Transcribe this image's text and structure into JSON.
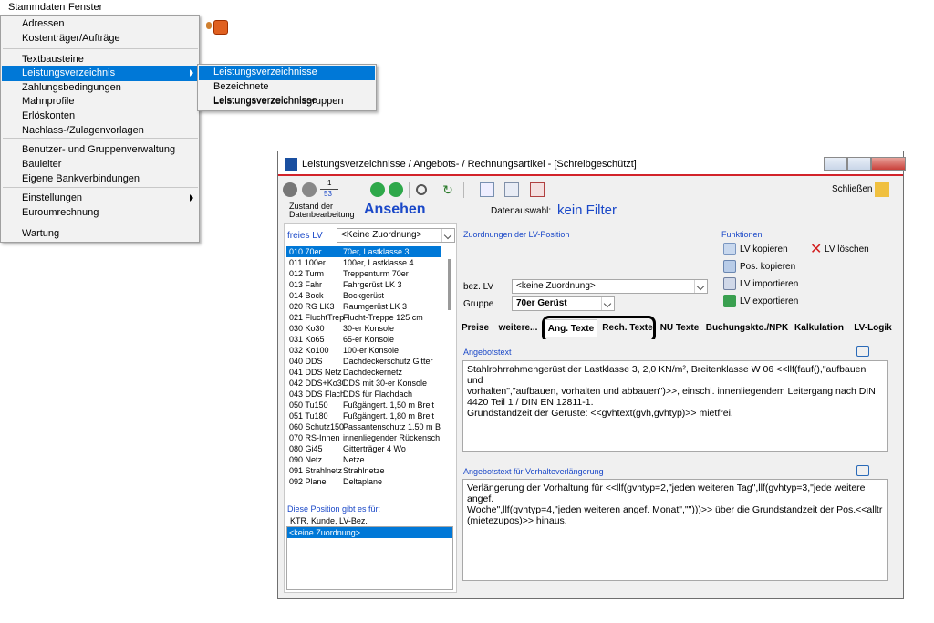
{
  "menubar": {
    "stammdaten": "Stammdaten",
    "fenster": "Fenster"
  },
  "dropdown": {
    "items": [
      {
        "label": "Adressen"
      },
      {
        "label": "Kostenträger/Aufträge"
      },
      {
        "label": "Textbausteine"
      },
      {
        "label": "Leistungsverzeichnis"
      },
      {
        "label": "Zahlungsbedingungen"
      },
      {
        "label": "Mahnprofile"
      },
      {
        "label": "Erlöskonten"
      },
      {
        "label": "Nachlass-/Zulagenvorlagen"
      },
      {
        "label": "Benutzer- und Gruppenverwaltung"
      },
      {
        "label": "Bauleiter"
      },
      {
        "label": "Eigene Bankverbindungen"
      },
      {
        "label": "Einstellungen"
      },
      {
        "label": "Euroumrechnung"
      },
      {
        "label": "Wartung"
      }
    ]
  },
  "submenu": {
    "items": [
      {
        "label": "Leistungsverzeichnisse"
      },
      {
        "label": "Bezeichnete Leistungsverzeichnisse"
      },
      {
        "label": "Leistungsverzeichnisgruppen"
      }
    ]
  },
  "window": {
    "title": "Leistungsverzeichnisse / Angebots- / Rechnungsartikel - [Schreibgeschützt]",
    "page_current": "1",
    "page_total": "53",
    "close_label": "Schließen",
    "state_label": "Zustand der Datenbearbeitung",
    "state_value": "Ansehen",
    "filter_label": "Datenauswahl:",
    "filter_value": "kein Filter"
  },
  "left": {
    "label": "freies LV",
    "combo_value": "<Keine Zuordnung>",
    "rows": [
      {
        "code": "010 70er",
        "name": "70er, Lastklasse 3"
      },
      {
        "code": "011 100er",
        "name": "100er, Lastklasse 4"
      },
      {
        "code": "012 Turm",
        "name": "Treppenturm 70er"
      },
      {
        "code": "013 Fahr",
        "name": "Fahrgerüst LK 3"
      },
      {
        "code": "014 Bock",
        "name": "Bockgerüst"
      },
      {
        "code": "020 RG LK3",
        "name": "Raumgerüst LK 3"
      },
      {
        "code": "021 FluchtTrepp",
        "name": "Flucht-Treppe 125 cm"
      },
      {
        "code": "030 Ko30",
        "name": "30-er Konsole"
      },
      {
        "code": "031 Ko65",
        "name": "65-er Konsole"
      },
      {
        "code": "032 Ko100",
        "name": "100-er Konsole"
      },
      {
        "code": "040 DDS",
        "name": "Dachdeckerschutz Gitter"
      },
      {
        "code": "041 DDS Netz",
        "name": "Dachdeckernetz"
      },
      {
        "code": "042 DDS+Ko30",
        "name": "DDS mit 30-er Konsole"
      },
      {
        "code": "043 DDS Flach",
        "name": "DDS für Flachdach"
      },
      {
        "code": "050 Tu150",
        "name": "Fußgängert. 1,50 m Breit"
      },
      {
        "code": "051 Tu180",
        "name": "Fußgängert. 1,80 m Breit"
      },
      {
        "code": "060 Schutz150",
        "name": "Passantenschutz 1.50 m B"
      },
      {
        "code": "070 RS-Innen",
        "name": "innenliegender Rückensch"
      },
      {
        "code": "080 Gi45",
        "name": "Gitterträger 4 Wo"
      },
      {
        "code": "090 Netz",
        "name": "Netze"
      },
      {
        "code": "091 Strahlnetz",
        "name": "Strahlnetze"
      },
      {
        "code": "092 Plane",
        "name": "Deltaplane"
      }
    ],
    "position_label": "Diese Position gibt es für:",
    "position_cols": "KTR, Kunde, LV-Bez.",
    "position_value": "<keine Zuordnung>"
  },
  "assign": {
    "title": "Zuordnungen der LV-Position",
    "bez_label": "bez. LV",
    "bez_value": "<keine Zuordnung>",
    "gruppe_label": "Gruppe",
    "gruppe_value": "70er Gerüst"
  },
  "functions": {
    "title": "Funktionen",
    "copy_lv": "LV kopieren",
    "delete_lv": "LV löschen",
    "copy_pos": "Pos. kopieren",
    "import_lv": "LV importieren",
    "export_lv": "LV exportieren"
  },
  "tabs": [
    {
      "label": "Preise"
    },
    {
      "label": "weitere..."
    },
    {
      "label": "Ang. Texte"
    },
    {
      "label": "Rech. Texte"
    },
    {
      "label": "NU Texte"
    },
    {
      "label": "Buchungskto./NPK"
    },
    {
      "label": "Kalkulation"
    },
    {
      "label": "LV-Logik"
    }
  ],
  "offer": {
    "title": "Angebotstext",
    "lines": [
      "Stahlrohrrahmengerüst der Lastklasse 3, 2,0 KN/m², Breitenklasse W 06 <<llf(fauf(),\"aufbauen und",
      "vorhalten\",\"aufbauen, vorhalten und abbauen\")>>, einschl. innenliegendem Leitergang nach DIN",
      "4420 Teil 1 / DIN EN 12811-1.",
      "Grundstandzeit der Gerüste: <<gvhtext(gvh,gvhtyp)>> mietfrei."
    ]
  },
  "extension": {
    "title": "Angebotstext für Vorhalteverlängerung",
    "lines": [
      "Verlängerung der Vorhaltung für <<llf(gvhtyp=2,\"jeden weiteren Tag\",llf(gvhtyp=3,\"jede weitere angef.",
      "Woche\",llf(gvhtyp=4,\"jeden weiteren angef. Monat\",\"\")))>> über die Grundstandzeit der Pos.<<alltr",
      "(mietezupos)>> hinaus."
    ]
  },
  "colors": {
    "highlight": "#0078d7",
    "accent_red": "#d2232a",
    "label_blue": "#1a48c8"
  }
}
